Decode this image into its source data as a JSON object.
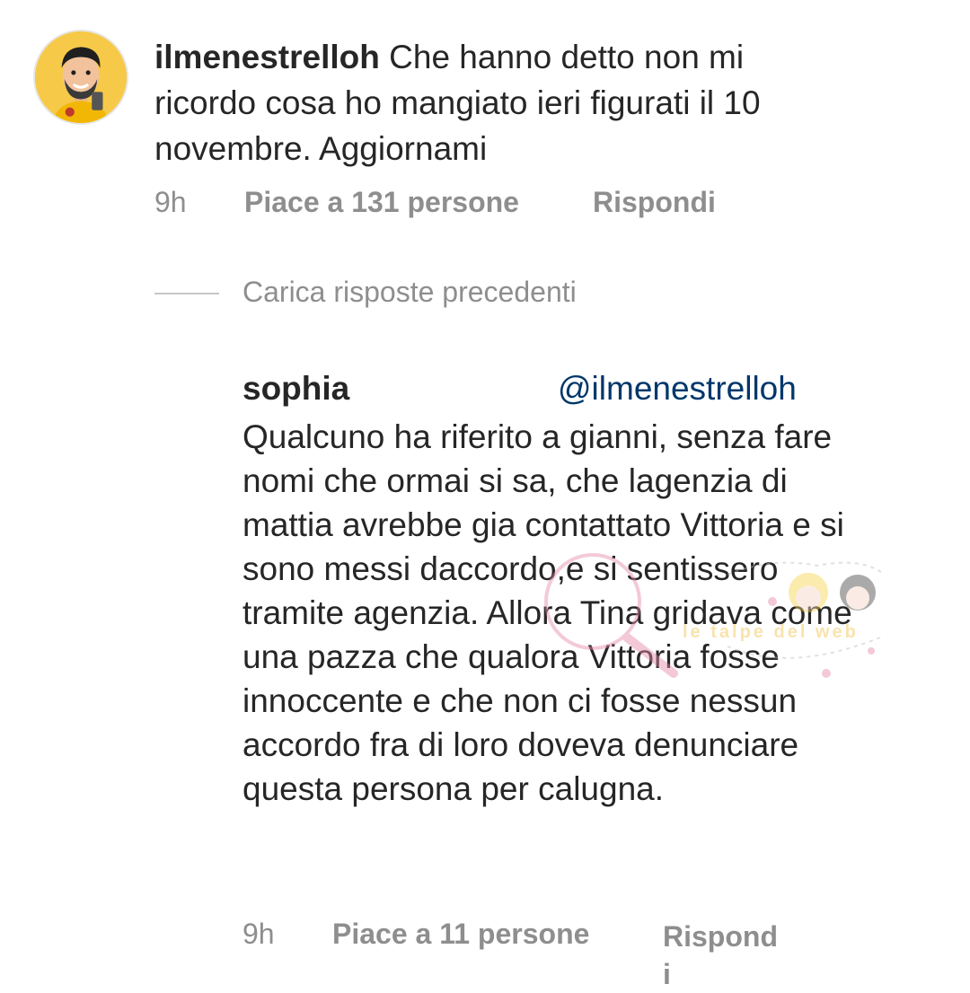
{
  "comment": {
    "username": "ilmenestrelloh",
    "text": "Che hanno detto non mi ricordo cosa ho mangiato ieri figurati il 10 novembre. Aggiornami",
    "time": "9h",
    "likes": "Piace a 131 persone",
    "reply": "Rispondi"
  },
  "load_previous": "Carica risposte precedenti",
  "reply_comment": {
    "username": "sophia",
    "mention": "@ilmenestrelloh",
    "text": "Qualcuno ha riferito a gianni, senza fare nomi che ormai si sa, che lagenzia di mattia avrebbe gia contattato Vittoria e si sono messi daccordo,e si sentissero tramite agenzia. Allora Tina gridava come una pazza che qualora Vittoria fosse innoccente e che non ci fosse nessun accordo fra di loro doveva denunciare questa persona per calugna.",
    "time": "9h",
    "likes": "Piace a 11 persone",
    "reply_line1": "Rispond",
    "reply_line2": "i"
  },
  "watermark": {
    "text": "le talpe del web"
  },
  "colors": {
    "text": "#262626",
    "secondary": "#8e8e8e",
    "mention": "#00376b",
    "avatar_bg": "#f7c948"
  }
}
